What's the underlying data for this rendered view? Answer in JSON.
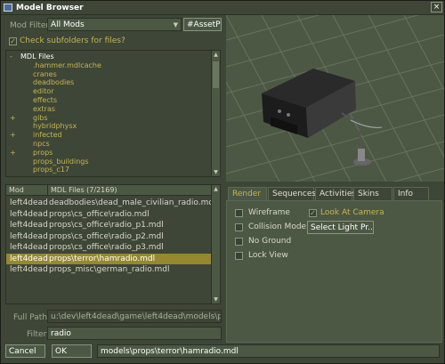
{
  "window": {
    "title": "Model Browser",
    "close_glyph": "×"
  },
  "filter_bar": {
    "mod_filter_label": "Mod Filter",
    "mod_filter_value": "All Mods",
    "asset_button_label": "#AssetPi...",
    "check_subfolders_label": "Check subfolders for files?",
    "check_subfolders_checked": true
  },
  "tree": {
    "items": [
      {
        "label": "MDL Files",
        "expander": "-",
        "root": true
      },
      {
        "label": ".hammer.mdlcache",
        "expander": ""
      },
      {
        "label": "cranes",
        "expander": ""
      },
      {
        "label": "deadbodies",
        "expander": ""
      },
      {
        "label": "editor",
        "expander": ""
      },
      {
        "label": "effects",
        "expander": ""
      },
      {
        "label": "extras",
        "expander": ""
      },
      {
        "label": "gibs",
        "expander": "+"
      },
      {
        "label": "hybridphysx",
        "expander": ""
      },
      {
        "label": "infected",
        "expander": "+"
      },
      {
        "label": "npcs",
        "expander": ""
      },
      {
        "label": "props",
        "expander": "+"
      },
      {
        "label": "props_buildings",
        "expander": ""
      },
      {
        "label": "props_c17",
        "expander": ""
      }
    ]
  },
  "file_list": {
    "col_mod": "Mod",
    "col_files": "MDL Files (7/2169)",
    "rows": [
      {
        "mod": "left4dead",
        "file": "deadbodies\\dead_male_civilian_radio.mdl",
        "selected": false
      },
      {
        "mod": "left4dead",
        "file": "props\\cs_office\\radio.mdl",
        "selected": false
      },
      {
        "mod": "left4dead",
        "file": "props\\cs_office\\radio_p1.mdl",
        "selected": false
      },
      {
        "mod": "left4dead",
        "file": "props\\cs_office\\radio_p2.mdl",
        "selected": false
      },
      {
        "mod": "left4dead",
        "file": "props\\cs_office\\radio_p3.mdl",
        "selected": false
      },
      {
        "mod": "left4dead",
        "file": "props\\terror\\hamradio.mdl",
        "selected": true
      },
      {
        "mod": "left4dead",
        "file": "props_misc\\german_radio.mdl",
        "selected": false
      }
    ]
  },
  "path_fields": {
    "full_path_label": "Full Path",
    "full_path_value": "u:\\dev\\left4dead\\game\\left4dead\\models\\props\\te",
    "filter_label": "Filter",
    "filter_value": "radio"
  },
  "tabs": [
    {
      "label": "Render",
      "active": true
    },
    {
      "label": "Sequences",
      "active": false
    },
    {
      "label": "Activities",
      "active": false
    },
    {
      "label": "Skins",
      "active": false
    },
    {
      "label": "Info",
      "active": false
    }
  ],
  "render_options": {
    "wireframe": {
      "label": "Wireframe",
      "checked": false
    },
    "look_at_camera": {
      "label": "Look At Camera",
      "checked": true
    },
    "collision_model": {
      "label": "Collision Model",
      "checked": false
    },
    "no_ground": {
      "label": "No Ground",
      "checked": false
    },
    "lock_view": {
      "label": "Lock View",
      "checked": false
    },
    "select_light_label": "Select Light Pr..."
  },
  "bottom_bar": {
    "cancel_label": "Cancel",
    "ok_label": "OK",
    "selected_path": "models\\props\\terror\\hamradio.mdl"
  },
  "colors": {
    "background": "#3e4637",
    "highlight": "#958830",
    "folder_text": "#c4b550"
  }
}
